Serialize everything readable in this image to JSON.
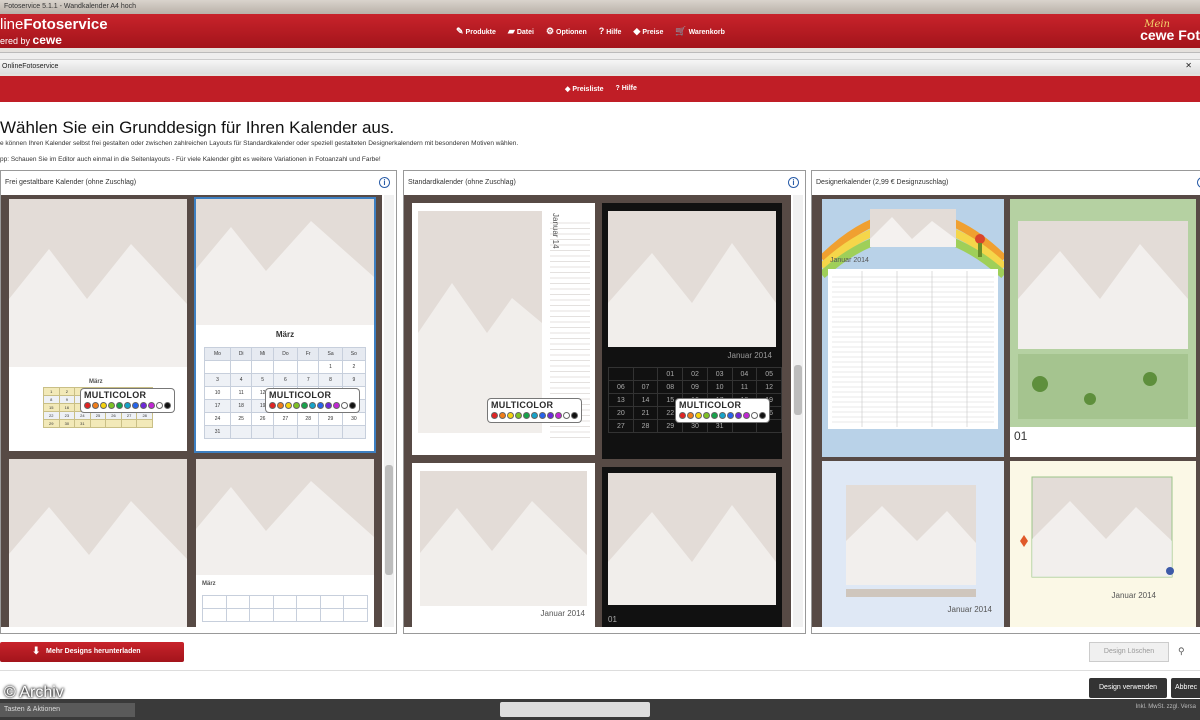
{
  "window": {
    "title": "Fotoservice 5.1.1 - Wandkalender A4 hoch"
  },
  "header": {
    "brand_line1_light": "line",
    "brand_line1_bold": "Fotoservice",
    "brand_line2_prefix": "ered by",
    "brand_line2_bold": "cewe",
    "nav": [
      "Produkte",
      "Datei",
      "Optionen",
      "Hilfe",
      "Preise",
      "Warenkorb"
    ],
    "mein_top": "Mein",
    "mein_bottom": "cewe Fot"
  },
  "subwindow": {
    "title": "OnlineFotoservice",
    "close": "✕"
  },
  "subnav": [
    "Preisliste",
    "Hilfe"
  ],
  "page": {
    "heading": "Wählen Sie ein Grunddesign für Ihren Kalender aus.",
    "intro": "e können Ihren Kalender selbst frei gestalten oder zwischen zahlreichen Layouts für Standardkalender oder speziell gestalteten Designerkalendern mit besonderen Motiven wählen.",
    "tip": "pp: Schauen Sie im Editor auch einmal in die Seitenlayouts - Für viele Kalender gibt es weitere Variationen in Fotoanzahl und Farbe!"
  },
  "panels": [
    {
      "title": "Frei gestaltbare Kalender (ohne Zuschlag)",
      "info": "i"
    },
    {
      "title": "Standardkalender (ohne Zuschlag)",
      "info": "i"
    },
    {
      "title": "Designerkalender (2,99 € Designzuschlag)",
      "info": "i"
    }
  ],
  "thumbs": {
    "month_maerz": "März",
    "weekdays": [
      "Mo",
      "Di",
      "Mi",
      "Do",
      "Fr",
      "Sa",
      "So"
    ],
    "maerz_days": [
      "",
      "",
      "",
      "",
      "",
      "1",
      "2",
      "3",
      "4",
      "5",
      "6",
      "7",
      "8",
      "9",
      "10",
      "11",
      "12",
      "13",
      "14",
      "15",
      "16",
      "17",
      "18",
      "19",
      "20",
      "21",
      "22",
      "23",
      "24",
      "25",
      "26",
      "27",
      "28",
      "29",
      "30",
      "31"
    ],
    "small_days": [
      "1",
      "2",
      "3",
      "4",
      "5",
      "6",
      "7",
      "8",
      "9",
      "10",
      "11",
      "12",
      "13",
      "14",
      "15",
      "16",
      "17",
      "18",
      "19",
      "20",
      "21",
      "22",
      "23",
      "24",
      "25",
      "26",
      "27",
      "28",
      "29",
      "30",
      "31"
    ],
    "multicolor": "MULTICOLOR",
    "januar_2014": "Januar 2014",
    "januar_14": "Januar 14",
    "dark_days": [
      "06",
      "07",
      "08",
      "09",
      "10",
      "11",
      "12",
      "13",
      "14",
      "15",
      "16",
      "17",
      "18",
      "19",
      "20",
      "21",
      "22",
      "23",
      "24",
      "25",
      "26",
      "27",
      "28",
      "29",
      "30",
      "31"
    ],
    "dark_top": [
      "01",
      "02",
      "03",
      "04",
      "05"
    ],
    "num_01": "01"
  },
  "footer": {
    "more_designs": "Mehr Designs herunterladen",
    "delete_design": "Design Löschen",
    "use_design": "Design verwenden",
    "cancel": "Abbrec",
    "archive": "© Archiv",
    "taskbar_left": "Tasten & Aktionen",
    "taskbar_right": "Inkl. MwSt. zzgl. Versa"
  },
  "colors": {
    "red": "#c01e26",
    "thumb_bg": "#574a45",
    "selected": "#3d7fc1"
  },
  "multicolor_dots": [
    "#e02424",
    "#f07d1a",
    "#f5d20f",
    "#7ec224",
    "#16a34a",
    "#16a3c9",
    "#2563eb",
    "#6d28d9",
    "#c026d3",
    "#ffffff",
    "#111111"
  ]
}
